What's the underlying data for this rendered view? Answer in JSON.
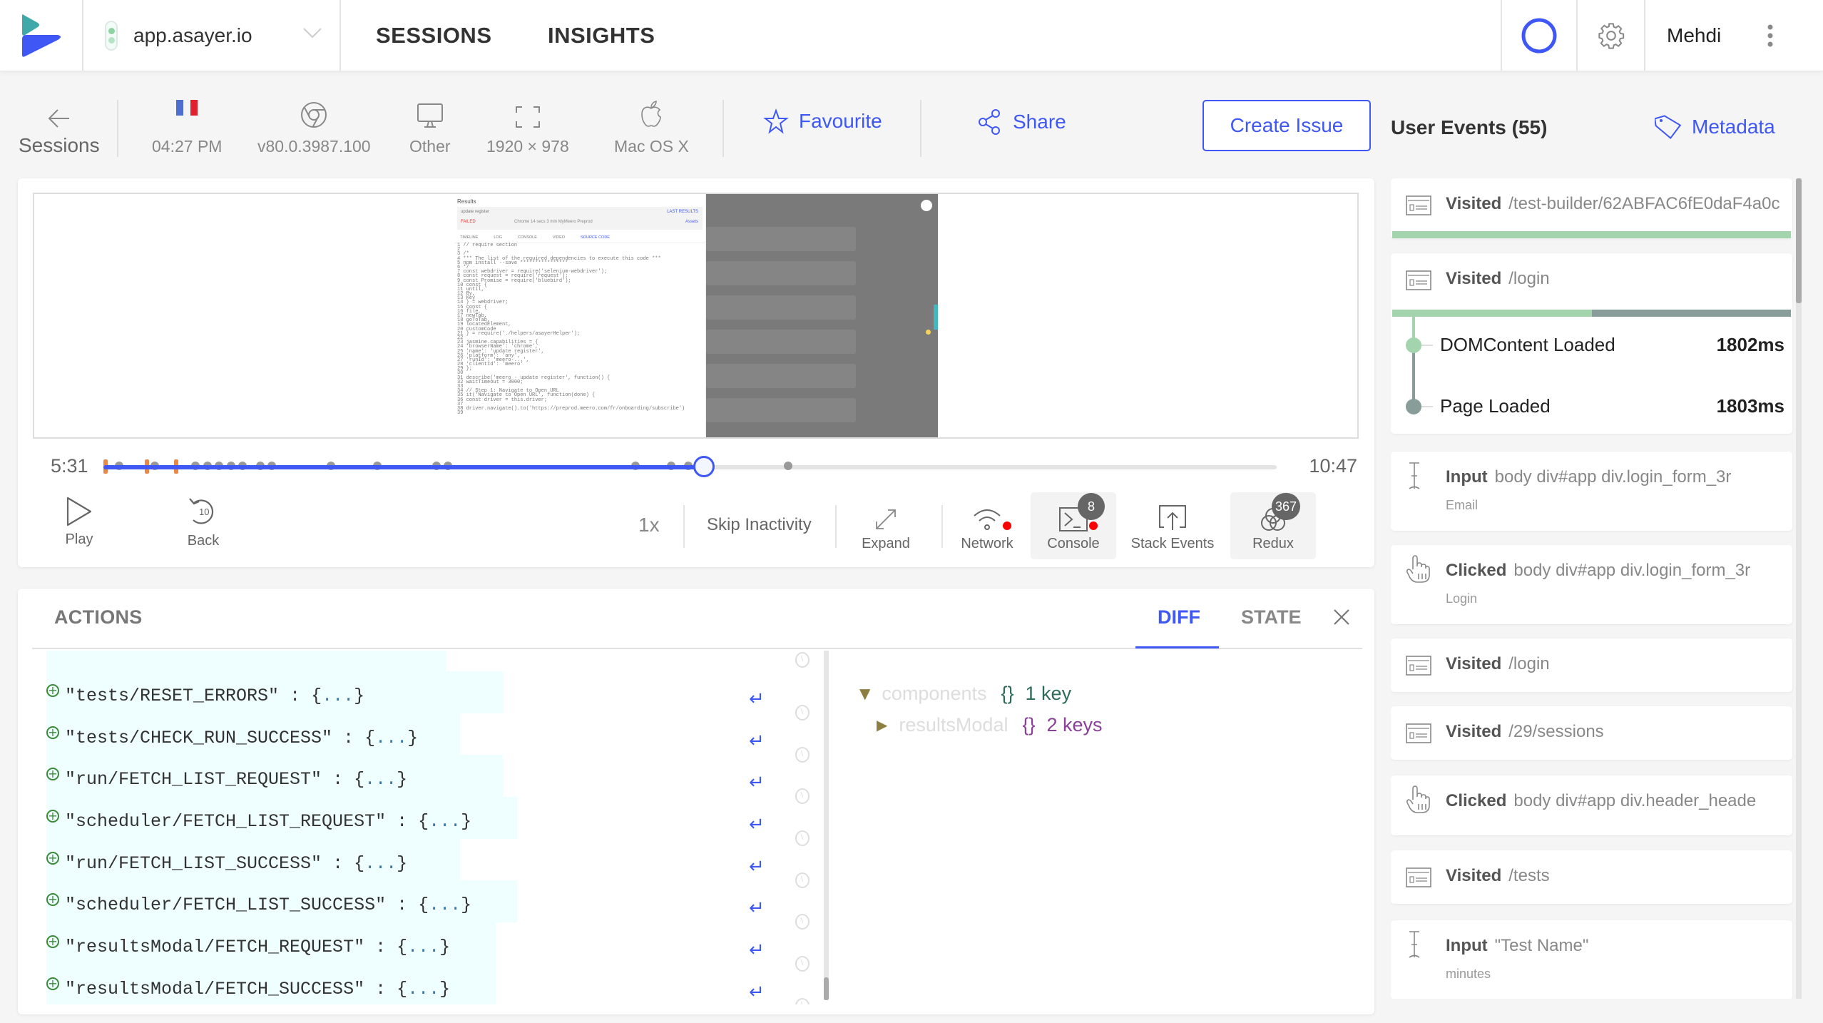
{
  "topnav": {
    "site": "app.asayer.io",
    "tabs": [
      "SESSIONS",
      "INSIGHTS"
    ],
    "user": "Mehdi",
    "brand_colors": {
      "teal": "#3fa8a8",
      "blue": "#3f58f5"
    }
  },
  "session_info": {
    "back_label": "Sessions",
    "country_flag": "France",
    "time": "04:27 PM",
    "browser_version": "v80.0.3987.100",
    "device": "Other",
    "resolution": "1920 × 978",
    "os": "Mac OS X",
    "favourite_label": "Favourite",
    "share_label": "Share",
    "create_issue_label": "Create Issue",
    "events_title": "User Events (55)",
    "metadata_label": "Metadata"
  },
  "player": {
    "current_time": "5:31",
    "total_time": "10:47",
    "progress_fraction": 0.512,
    "controls": {
      "play": "Play",
      "back": "Back",
      "back_seconds": "10",
      "speed": "1x",
      "skip": "Skip Inactivity",
      "expand": "Expand",
      "network": "Network",
      "console": "Console",
      "console_count": "8",
      "stack_events": "Stack Events",
      "redux": "Redux",
      "redux_count": "367"
    },
    "preview": {
      "title": "Results",
      "test_name": "update register",
      "last_results": "LAST RESULTS",
      "status": "FAILED",
      "meta": "Chrome  14 secs  3 min  MyMeero Preprod",
      "assets": "Assets",
      "tabs": [
        "TIMELINE",
        "LOG",
        "CONSOLE",
        "VIDEO",
        "SOURCE CODE"
      ],
      "code": [
        "1 // require section",
        "2",
        "3 /*",
        "4 *** The list of the required dependencies to execute this code ***",
        "5 npm install --save ****************",
        "6 */",
        "7 const webdriver = require('selenium-webdriver');",
        "8 const request = require('request');",
        "9 const Promise = require('bluebird');",
        "10 const {",
        "11     until,",
        "12     By,",
        "13     Key",
        "14 } = webdriver;",
        "15 const {",
        "16     file,",
        "17     newTab,",
        "18     goToTab,",
        "19     locatedElement,",
        "20     customCode",
        "21 } = require('./helpers/asayerHelper');",
        "22",
        "23 jasmine.capabilities = {",
        "24     'browserName': 'chrome',",
        "25     'name': 'update register',",
        "26     'platform': 'any',",
        "27     'runId': 'meero-...',",
        "28     'clientId': 'meero'",
        "29 };",
        "30",
        "31 describe('meero - update register', function() {",
        "32     waitTimeout = 3000;",
        "33",
        "34     // Step 1: Navigate to Open URL",
        "35     it('Navigate to Open URL', function(done) {",
        "36         const driver = this.driver;",
        "37",
        "38         driver.navigate().to('https://preprod.meero.com/fr/onboarding/subscribe')",
        "39"
      ]
    }
  },
  "actions_panel": {
    "title": "ACTIONS",
    "tabs": [
      "DIFF",
      "STATE"
    ],
    "active_tab": "DIFF",
    "items": [
      {
        "name": "\"tests/RESET_ERRORS\"",
        "sep": " : {",
        "ellipsis": "...",
        "close": "}"
      },
      {
        "name": "\"tests/CHECK_RUN_SUCCESS\"",
        "sep": " : {",
        "ellipsis": "...",
        "close": "}"
      },
      {
        "name": "\"run/FETCH_LIST_REQUEST\"",
        "sep": " : {",
        "ellipsis": "...",
        "close": "}"
      },
      {
        "name": "\"scheduler/FETCH_LIST_REQUEST\"",
        "sep": " : {",
        "ellipsis": "...",
        "close": "}"
      },
      {
        "name": "\"run/FETCH_LIST_SUCCESS\"",
        "sep": " : {",
        "ellipsis": "...",
        "close": "}"
      },
      {
        "name": "\"scheduler/FETCH_LIST_SUCCESS\"",
        "sep": " : {",
        "ellipsis": "...",
        "close": "}"
      },
      {
        "name": "\"resultsModal/FETCH_REQUEST\"",
        "sep": " : {",
        "ellipsis": "...",
        "close": "}"
      },
      {
        "name": "\"resultsModal/FETCH_SUCCESS\"",
        "sep": " : {",
        "ellipsis": "...",
        "close": "}"
      }
    ],
    "diff": [
      {
        "key": "components",
        "brace": "{}",
        "count": "1 key",
        "expanded": true,
        "color": "#2f6b5a"
      },
      {
        "key": "resultsModal",
        "brace": "{}",
        "count": "2 keys",
        "expanded": false,
        "color": "#8a3f99"
      }
    ]
  },
  "events": [
    {
      "type": "Visited",
      "value": "/test-builder/62ABFAC6fE0daF4a0c",
      "icon": "page-icon"
    },
    {
      "type": "Visited",
      "value": "/login",
      "icon": "page-icon",
      "timings": [
        {
          "label": "DOMContent Loaded",
          "value": "1802ms"
        },
        {
          "label": "Page Loaded",
          "value": "1803ms"
        }
      ],
      "dom_fraction": 0.5
    },
    {
      "type": "Input",
      "value": "body div#app div.login_form_3r",
      "sub": "Email",
      "icon": "text-cursor-icon"
    },
    {
      "type": "Clicked",
      "value": "body div#app div.login_form_3r",
      "sub": "Login",
      "icon": "hand-pointer-icon"
    },
    {
      "type": "Visited",
      "value": "/login",
      "icon": "page-icon"
    },
    {
      "type": "Visited",
      "value": "/29/sessions",
      "icon": "page-icon"
    },
    {
      "type": "Clicked",
      "value": "body div#app div.header_heade",
      "icon": "hand-pointer-icon"
    },
    {
      "type": "Visited",
      "value": "/tests",
      "icon": "page-icon"
    },
    {
      "type": "Input",
      "value": "\"Test Name\"",
      "sub": "minutes",
      "icon": "text-cursor-icon"
    }
  ]
}
